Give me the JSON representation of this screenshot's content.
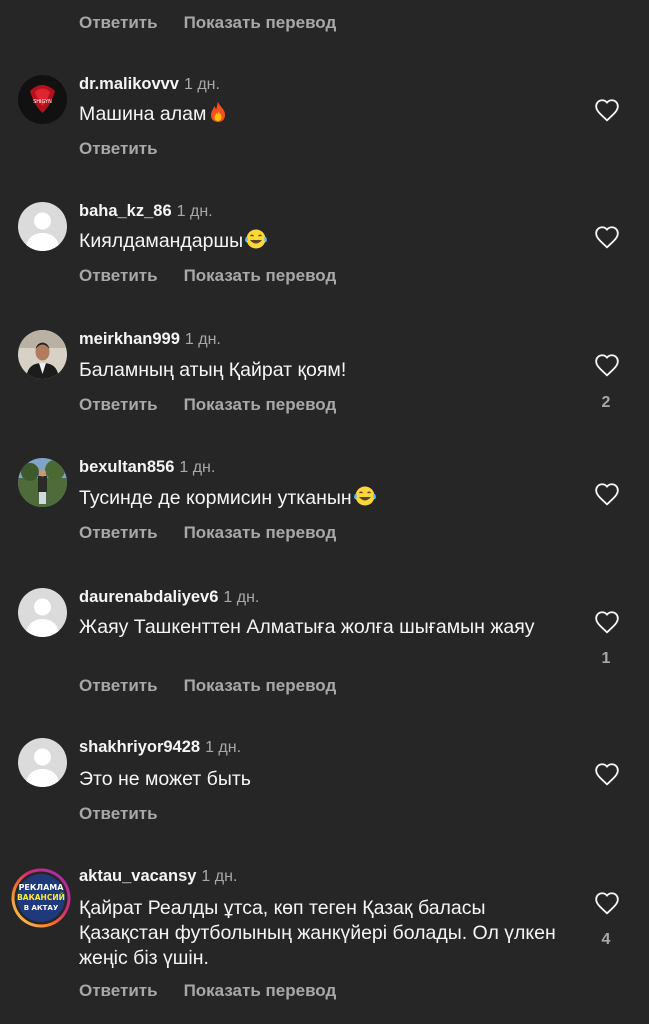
{
  "labels": {
    "reply": "Ответить",
    "translate": "Показать перевод"
  },
  "comments": [
    {
      "username": "dr.malikovvv",
      "time": "1 дн.",
      "text": "Машина алам",
      "emoji": "fire",
      "likes": null,
      "has_translate": false,
      "avatar": "red-logo-avatar"
    },
    {
      "username": "baha_kz_86",
      "time": "1 дн.",
      "text": "Киялдамандаршы",
      "emoji": "laugh-tears",
      "likes": null,
      "has_translate": true,
      "avatar": "default-avatar"
    },
    {
      "username": "meirkhan999",
      "time": "1 дн.",
      "text": "Баламның атың Қайрат қоям!",
      "emoji": null,
      "likes": "2",
      "has_translate": true,
      "avatar": "photo-avatar"
    },
    {
      "username": "bexultan856",
      "time": "1 дн.",
      "text": "Тусинде де кормисин утканын",
      "emoji": "laugh-tears",
      "likes": null,
      "has_translate": true,
      "avatar": "photo-avatar"
    },
    {
      "username": "daurenabdaliyev6",
      "time": "1 дн.",
      "text": "Жаяу Ташкенттен Алматыға жолға шығамын жаяу",
      "emoji": null,
      "likes": "1",
      "has_translate": true,
      "avatar": "default-avatar"
    },
    {
      "username": "shakhriyor9428",
      "time": "1 дн.",
      "text": "Это не может быть",
      "emoji": null,
      "likes": null,
      "has_translate": false,
      "avatar": "default-avatar"
    },
    {
      "username": "aktau_vacansy",
      "time": "1 дн.",
      "text": "Қайрат Реалды ұтса, көп теген Қазақ баласы Қазақстан футболының жанкүйері болады. Ол үлкен жеңіс біз үшін.",
      "emoji": null,
      "likes": "4",
      "has_translate": true,
      "avatar": "story-ring-avatar"
    }
  ],
  "avatar_text": {
    "malikov_logo": "SHIGYN",
    "aktau_line1": "РЕКЛАМА",
    "aktau_line2": "ВАКАНСИЙ",
    "aktau_line3": "В АКТАУ"
  },
  "colors": {
    "background": "#262626",
    "primary_text": "#f5f5f5",
    "secondary_text": "#a8a8a8",
    "default_avatar": "#dbdbdb"
  }
}
